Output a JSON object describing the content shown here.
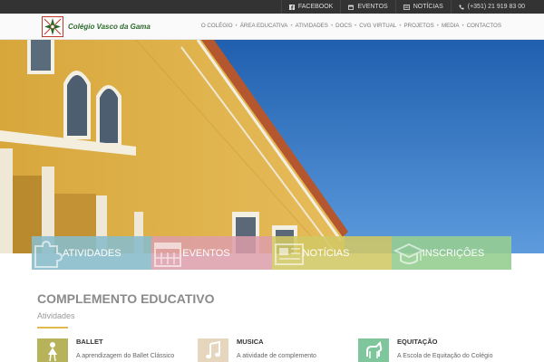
{
  "topbar": {
    "facebook": "FACEBOOK",
    "eventos": "EVENTOS",
    "noticias": "NOTÍCIAS",
    "phone": "(+351) 21 919 83 00"
  },
  "header": {
    "logo_text": "Colégio Vasco da Gama",
    "nav": [
      "O COLÉGIO",
      "ÁREA EDUCATIVA",
      "ATIVIDADES",
      "DOCS",
      "CVG VIRTUAL",
      "PROJETOS",
      "MEDIA",
      "CONTACTOS"
    ]
  },
  "tiles": [
    {
      "label": "ATIVIDADES",
      "icon": "puzzle-icon"
    },
    {
      "label": "EVENTOS",
      "icon": "calendar-icon"
    },
    {
      "label": "NOTÍCIAS",
      "icon": "newspaper-icon"
    },
    {
      "label": "INSCRIÇÕES",
      "icon": "graduation-cap-icon"
    }
  ],
  "section": {
    "title": "COMPLEMENTO EDUCATIVO",
    "subtitle": "Atividades"
  },
  "features": [
    {
      "title": "BALLET",
      "desc": "A aprendizagem do Ballet Clássico",
      "icon": "ballet-icon",
      "color": "#b7b35a"
    },
    {
      "title": "MUSICA",
      "desc": "A atividade de complemento",
      "icon": "music-note-icon",
      "color": "#e6d6bd"
    },
    {
      "title": "EQUITAÇÃO",
      "desc": "A Escola de Equitação do Colégio",
      "icon": "horse-icon",
      "color": "#7fc69d"
    }
  ],
  "colors": {
    "topbar": "#333333",
    "accent": "#e0b94f",
    "logo_green": "#2b6a2b"
  }
}
